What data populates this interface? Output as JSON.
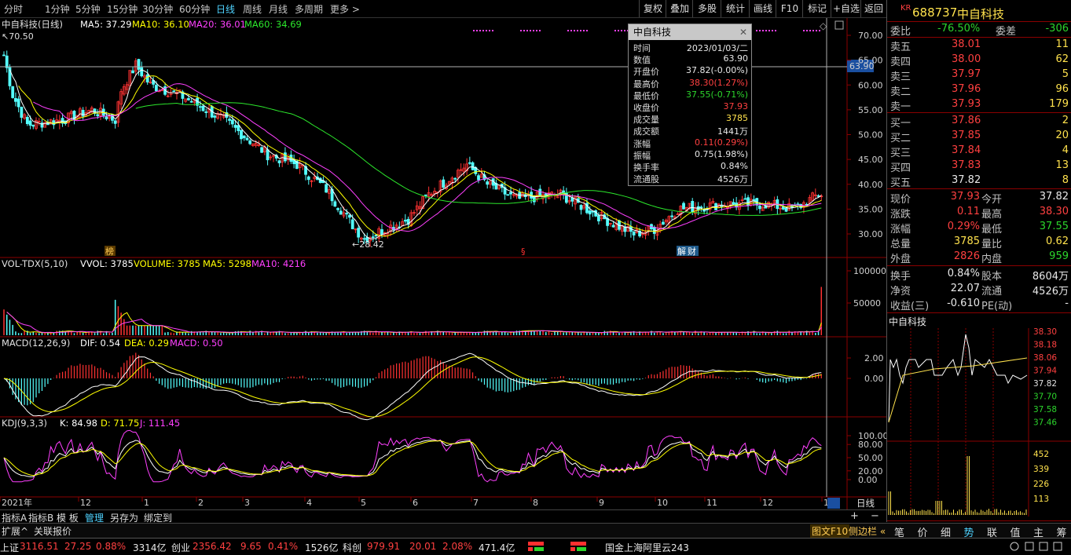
{
  "period_tabs": [
    "分时",
    "1分钟",
    "5分钟",
    "15分钟",
    "30分钟",
    "60分钟",
    "日线",
    "周线",
    "月线",
    "多周期",
    "更多 >"
  ],
  "active_tab": "日线",
  "toolbar_buttons": [
    "复权",
    "叠加",
    "多股",
    "统计",
    "画线",
    "F10",
    "标记",
    "+自选",
    "返回"
  ],
  "main_chart": {
    "header_name": "中自科技(日线)",
    "ma5": "MA5: 37.29",
    "ma10": "MA10: 36.10",
    "ma20": "MA20: 36.01",
    "ma60": "MA60: 34.69",
    "high_marker": "70.50",
    "low_marker": "28.42",
    "price_ticks": [
      "70.00",
      "65.00",
      "60.00",
      "55.00",
      "50.00",
      "45.00",
      "40.00",
      "35.00",
      "30.00"
    ],
    "crosshair_value": "63.90",
    "event_tags": [
      "榜",
      "§",
      "解",
      "财"
    ],
    "colors": {
      "up": "#ff3232",
      "down": "#54ffff",
      "ma5": "#ffffff",
      "ma10": "#ffff00",
      "ma20": "#ff40ff",
      "ma60": "#2ce82c"
    }
  },
  "volume_panel": {
    "header": "VOL-TDX(5,10)",
    "vvol": "VVOL: 3785",
    "volume": "VOLUME: 3785",
    "ma5": "MA5: 5298",
    "ma10": "MA10: 4216",
    "ticks": [
      "100000",
      "50000"
    ]
  },
  "macd_panel": {
    "header": "MACD(12,26,9)",
    "dif": "DIF: 0.54",
    "dea": "DEA: 0.29",
    "macd": "MACD: 0.50",
    "ticks": [
      "2.00",
      "0.00"
    ]
  },
  "kdj_panel": {
    "header": "KDJ(9,3,3)",
    "k": "K: 84.98",
    "d": "D: 71.75",
    "j": "J: 111.45",
    "ticks": [
      "100.00",
      "80.00",
      "50.00",
      "20.00",
      "0.00"
    ]
  },
  "x_axis_months": [
    "2021年",
    "12",
    "1",
    "2",
    "3",
    "4",
    "5",
    "6",
    "7",
    "8",
    "9",
    "10",
    "11",
    "12",
    "1"
  ],
  "period_label": "日线",
  "tooltip": {
    "title": "中自科技",
    "rows": [
      {
        "k": "时间",
        "v": "2023/01/03/二",
        "c": "white"
      },
      {
        "k": "数值",
        "v": "63.90",
        "c": "white"
      },
      {
        "k": "开盘价",
        "v": "37.82(-0.00%)",
        "c": "white"
      },
      {
        "k": "最高价",
        "v": "38.30(1.27%)",
        "c": "red"
      },
      {
        "k": "最低价",
        "v": "37.55(-0.71%)",
        "c": "green"
      },
      {
        "k": "收盘价",
        "v": "37.93",
        "c": "red"
      },
      {
        "k": "成交量",
        "v": "3785",
        "c": "yellow"
      },
      {
        "k": "成交额",
        "v": "1441万",
        "c": "white"
      },
      {
        "k": "涨幅",
        "v": "0.11(0.29%)",
        "c": "red"
      },
      {
        "k": "振幅",
        "v": "0.75(1.98%)",
        "c": "white"
      },
      {
        "k": "换手率",
        "v": "0.84%",
        "c": "white"
      },
      {
        "k": "流通股",
        "v": "4526万",
        "c": "white"
      }
    ]
  },
  "indicator_tabs": [
    "指标A",
    "指标B",
    "模 板",
    "管理",
    "另存为",
    "绑定到"
  ],
  "ext_tabs": [
    "扩展^",
    "关联报价"
  ],
  "side_tabs": [
    "图文F10",
    "侧边栏 «"
  ],
  "quote": {
    "badge": "KR",
    "code": "688737",
    "name": "中自科技",
    "webi_label": "委比",
    "webi": "-76.50%",
    "weicha_label": "委差",
    "weicha": "-306",
    "asks": [
      {
        "label": "卖五",
        "price": "38.01",
        "vol": "11"
      },
      {
        "label": "卖四",
        "price": "38.00",
        "vol": "62"
      },
      {
        "label": "卖三",
        "price": "37.97",
        "vol": "5"
      },
      {
        "label": "卖二",
        "price": "37.96",
        "vol": "96"
      },
      {
        "label": "卖一",
        "price": "37.93",
        "vol": "179"
      }
    ],
    "bids": [
      {
        "label": "买一",
        "price": "37.86",
        "vol": "2"
      },
      {
        "label": "买二",
        "price": "37.85",
        "vol": "20"
      },
      {
        "label": "买三",
        "price": "37.84",
        "vol": "4"
      },
      {
        "label": "买四",
        "price": "37.83",
        "vol": "13"
      },
      {
        "label": "买五",
        "price": "37.82",
        "vol": "8"
      }
    ],
    "stats": [
      {
        "l1": "现价",
        "v1": "37.93",
        "c1": "red",
        "l2": "今开",
        "v2": "37.82",
        "c2": "white"
      },
      {
        "l1": "涨跌",
        "v1": "0.11",
        "c1": "red",
        "l2": "最高",
        "v2": "38.30",
        "c2": "red"
      },
      {
        "l1": "涨幅",
        "v1": "0.29%",
        "c1": "red",
        "l2": "最低",
        "v2": "37.55",
        "c2": "green"
      },
      {
        "l1": "总量",
        "v1": "3785",
        "c1": "yellow",
        "l2": "量比",
        "v2": "0.62",
        "c2": "yellow"
      },
      {
        "l1": "外盘",
        "v1": "2826",
        "c1": "red",
        "l2": "内盘",
        "v2": "959",
        "c2": "green"
      }
    ],
    "stats2": [
      {
        "l1": "换手",
        "v1": "0.84%",
        "l2": "股本",
        "v2": "8604万"
      },
      {
        "l1": "净资",
        "v1": "22.07",
        "l2": "流通",
        "v2": "4526万"
      },
      {
        "l1": "收益(三)",
        "v1": "-0.610",
        "l2": "PE(动)",
        "v2": "-"
      }
    ],
    "mini_title": "中自科技",
    "mini_ticks": [
      "38.30",
      "38.18",
      "38.06",
      "37.94",
      "37.82",
      "37.70",
      "37.58",
      "37.46"
    ],
    "mini_vol_ticks": [
      "452",
      "339",
      "226",
      "113"
    ],
    "bottom_tabs": [
      "笔",
      "价",
      "细",
      "势",
      "联",
      "值",
      "主",
      "筹"
    ]
  },
  "ticker": {
    "sh": {
      "name": "上证",
      "val": "3116.51",
      "chg": "27.25",
      "pct": "0.88%",
      "amt": "3314亿"
    },
    "cy": {
      "name": "创业",
      "val": "2356.42",
      "chg": "9.65",
      "pct": "0.41%",
      "amt": "1526亿"
    },
    "kc": {
      "name": "科创",
      "val": "979.91",
      "chg": "20.01",
      "pct": "2.08%",
      "amt": "471.4亿"
    },
    "server": "国金上海阿里云243"
  }
}
